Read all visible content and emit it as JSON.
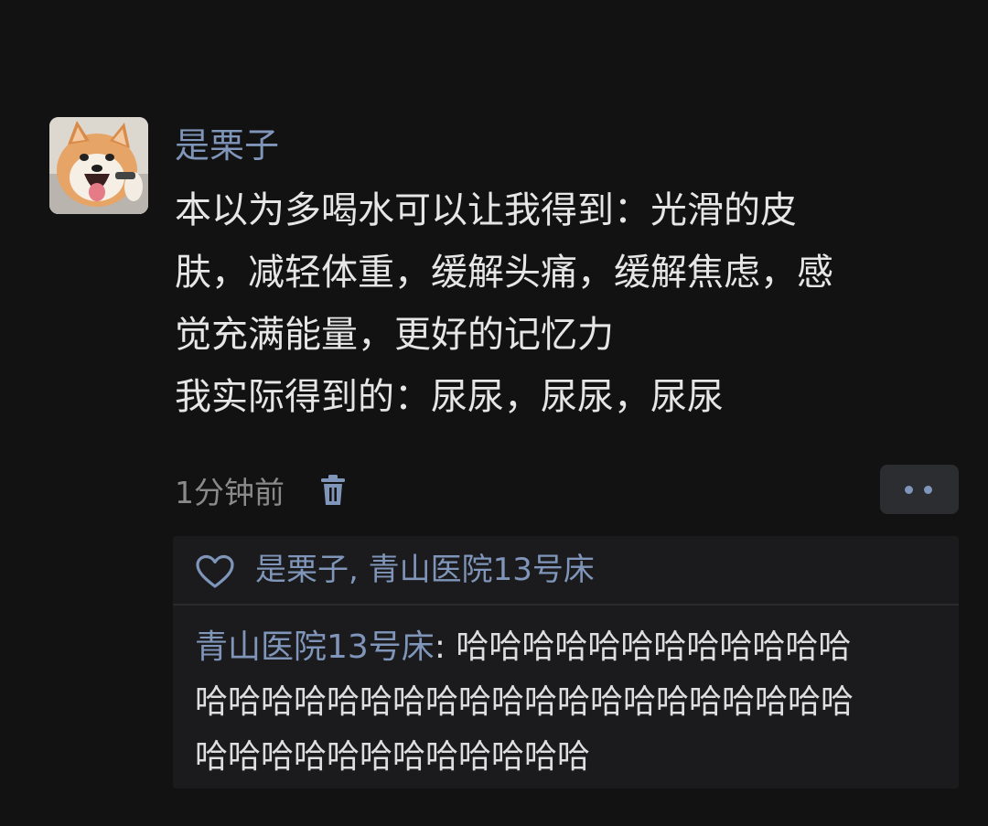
{
  "post": {
    "avatar_icon": "shiba-dog-avatar",
    "username": "是栗子",
    "lines": [
      "本以为多喝水可以让我得到：光滑的皮",
      "肤，减轻体重，缓解头痛，缓解焦虑，感",
      "觉充满能量，更好的记忆力",
      "我实际得到的：尿尿，尿尿，尿尿"
    ],
    "time": "1分钟前",
    "delete_icon": "trash-icon",
    "more_icon": "more-dots-icon"
  },
  "likes": {
    "icon": "heart-icon",
    "text": "是栗子, 青山医院13号床"
  },
  "comment": {
    "author": "青山医院13号床",
    "separator": ": ",
    "lines": [
      "哈哈哈哈哈哈哈哈哈哈哈哈",
      "哈哈哈哈哈哈哈哈哈哈哈哈哈哈哈哈哈哈哈哈",
      "哈哈哈哈哈哈哈哈哈哈哈哈"
    ]
  },
  "colors": {
    "background": "#121212",
    "link_blue": "#7f95b9",
    "text": "#e6e6e6",
    "muted": "#8a8a8a",
    "panel": "#1b1b1d"
  }
}
